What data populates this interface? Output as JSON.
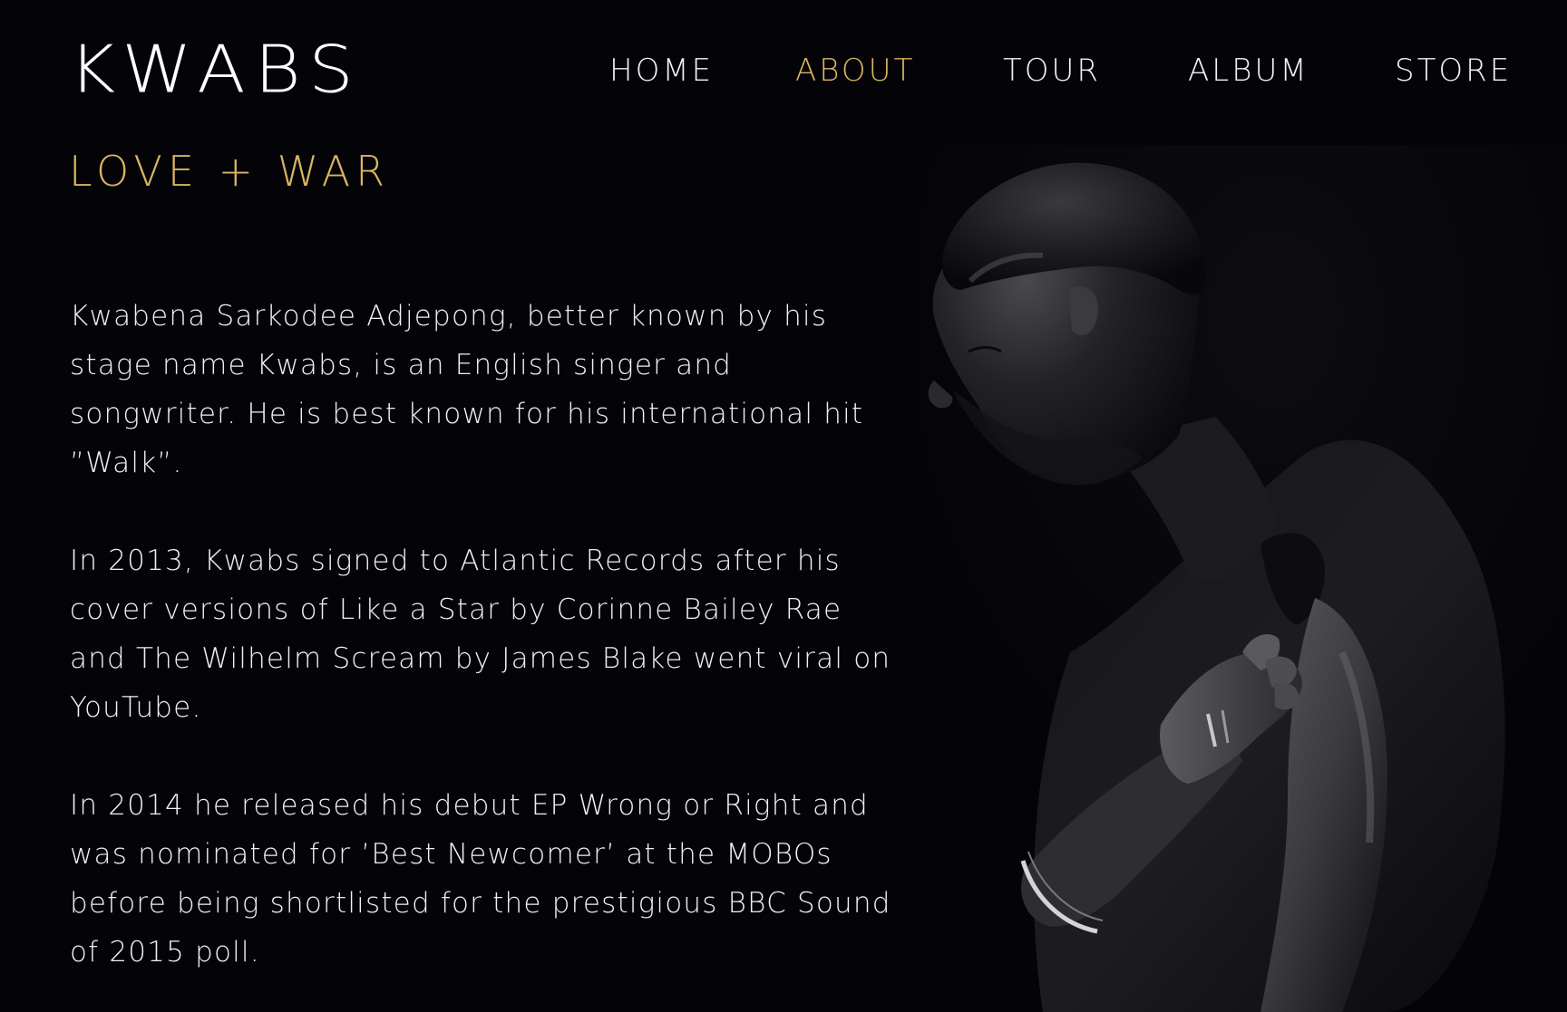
{
  "logo": {
    "title": "KWABS",
    "subtitle": "LOVE + WAR"
  },
  "nav": {
    "items": [
      {
        "label": "HOME",
        "active": false
      },
      {
        "label": "ABOUT",
        "active": true
      },
      {
        "label": "TOUR",
        "active": false
      },
      {
        "label": "ALBUM",
        "active": false
      },
      {
        "label": "STORE",
        "active": false
      }
    ]
  },
  "bio": {
    "paragraphs": [
      "Kwabena Sarkodee Adjepong, better known by his stage name Kwabs, is an English singer and songwriter. He is best known for his international hit ”Walk”.",
      "In 2013, Kwabs signed to Atlantic Records after his cover versions of Like a Star by Corinne Bailey Rae and The Wilhelm Scream by James Blake went viral on YouTube.",
      "In 2014 he released his debut EP Wrong or Right and was nominated for ’Best Newcomer’ at the MOBOs before being shortlisted for the prestigious BBC Sound of 2015 poll."
    ]
  },
  "colors": {
    "background": "#040408",
    "accent": "#d9b562",
    "text": "#f0f0f0"
  }
}
